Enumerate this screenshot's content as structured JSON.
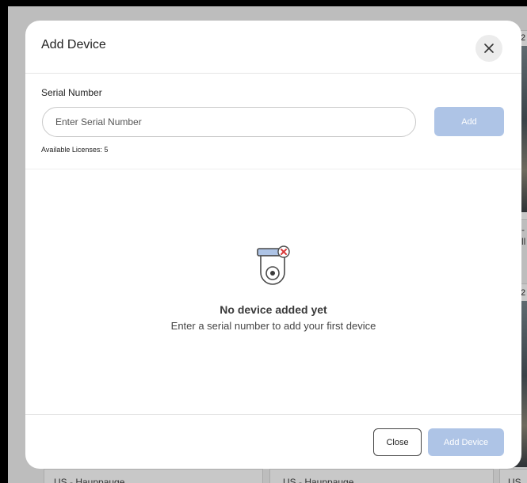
{
  "background": {
    "cards": [
      {
        "location": "US - Hauppauge"
      },
      {
        "location": "US - Hauppauge"
      },
      {
        "location": "US"
      }
    ],
    "date_fragments": [
      "2",
      "2"
    ],
    "text_fragments": [
      "-",
      "ll"
    ]
  },
  "modal": {
    "title": "Add Device",
    "close_icon": "close-icon",
    "serial_label": "Serial Number",
    "serial_placeholder": "Enter Serial Number",
    "serial_value": "",
    "add_label": "Add",
    "licenses_text": "Available Licenses: 5",
    "empty_state": {
      "icon": "camera-error-icon",
      "title": "No device added yet",
      "subtitle": "Enter a serial number to add your first device"
    },
    "footer": {
      "close_label": "Close",
      "add_device_label": "Add Device"
    }
  },
  "colors": {
    "primary_disabled": "#aec4e6",
    "error_red": "#d93a3a",
    "camera_blue": "#aec4e6"
  }
}
